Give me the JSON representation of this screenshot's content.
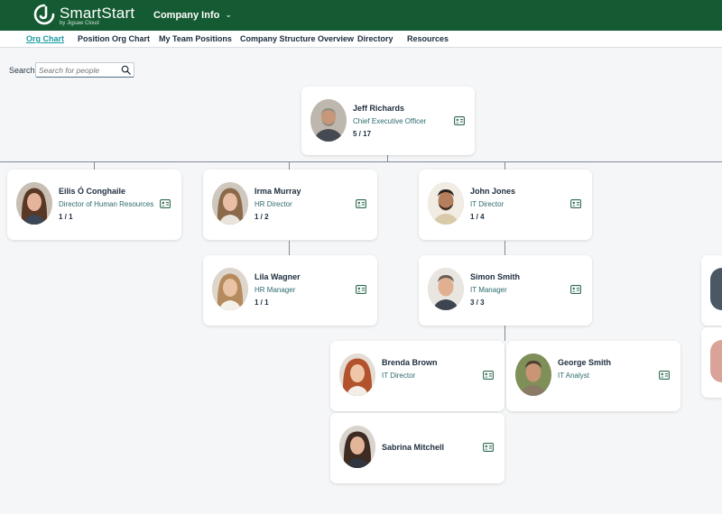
{
  "app": {
    "brand": "SmartStart",
    "brand_sub": "by Jigsaw Cloud",
    "menu_label": "Company Info",
    "colors": {
      "header": "#145a32",
      "accent": "#1a9aa0",
      "title_text": "#2d6a6e"
    }
  },
  "nav": {
    "items": [
      {
        "label": "Org Chart",
        "active": true
      },
      {
        "label": "Position Org Chart"
      },
      {
        "label": "My Team Positions"
      },
      {
        "label": "Company Structure Overview"
      },
      {
        "label": "Directory"
      },
      {
        "label": "Resources"
      }
    ]
  },
  "search": {
    "label": "Search:",
    "placeholder": "Search for people",
    "icon": "magnifier-icon"
  },
  "people": [
    {
      "name": "Jeff Richards",
      "title": "Chief Executive Officer",
      "count": "5 / 17"
    },
    {
      "name": "Eilis Ó Conghaile",
      "title": "Director of Human Resources",
      "count": "1 / 1"
    },
    {
      "name": "Irma Murray",
      "title": "HR Director",
      "count": "1 / 2"
    },
    {
      "name": "John Jones",
      "title": "IT Director",
      "count": "1 / 4"
    },
    {
      "name": "Lila Wagner",
      "title": "HR Manager",
      "count": "1 / 1"
    },
    {
      "name": "Simon Smith",
      "title": "IT Manager",
      "count": "3 / 3"
    },
    {
      "name": "Brenda Brown",
      "title": "IT Director",
      "count": ""
    },
    {
      "name": "George Smith",
      "title": "IT Analyst",
      "count": ""
    },
    {
      "name": "Sabrina Mitchell",
      "title": "",
      "count": ""
    }
  ]
}
